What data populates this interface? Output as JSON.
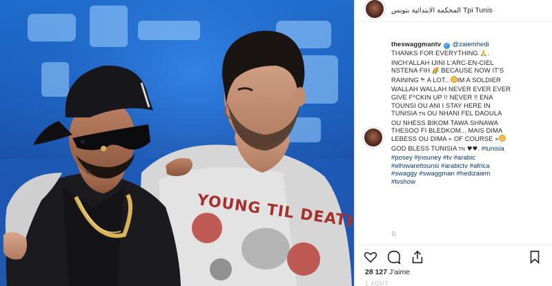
{
  "post": {
    "location_arabic": "المحكمة الابتدائية بتونس",
    "location_latin": "Tpi Tunis",
    "username": "theswaggmantv",
    "mention": "@zaiemhedi",
    "caption_lines": [
      "THANKS FOR EVERYTHING",
      "INCH'ALLAH IJINI L'ARC-EN-CIEL",
      "NSTENA FIH",
      "BECAUSE NOW IT'S",
      "RAINING",
      "A LOT...",
      "IM A SOLDIER",
      "WALLAH WALLAH NEVER EVER EVER",
      "GIVE F*CKIN UP !! NEVER !! ENA",
      "TOUNSI OU ANI I STAY HERE IN",
      "TUNISIA",
      "OU NHANI FEL DAOULA",
      "OU NHESS BIKOM TAWA SHNAWA",
      "THESOO FI BLEDKOM... MAIS DIMA",
      "LEBESS OU DIMA",
      "OF COURSE",
      "GOD BLESS TUNISIA",
      "#tunisia"
    ],
    "flag_text": "TN",
    "hashtags_lines": [
      "#posey #jnouney #tv #arabic",
      "#elhiwarettounsi #arabictv #africa",
      "#swaggy #swaggman #hedizaiem",
      "#tvshow"
    ],
    "time_hint": "1j",
    "likes_count": "28 127",
    "likes_label": "J'aime",
    "date_peek": "1 AOUT"
  },
  "photo": {
    "shirt_text": "YOUNG TIL DEATH"
  },
  "icons": {
    "like": "heart-icon",
    "comment": "comment-icon",
    "share": "share-icon",
    "save": "bookmark-icon",
    "verified": "verified-badge-icon"
  },
  "colors": {
    "link": "#003569",
    "text": "#262626",
    "verified": "#3897f0",
    "studio_blue": "#1a5fbf"
  }
}
